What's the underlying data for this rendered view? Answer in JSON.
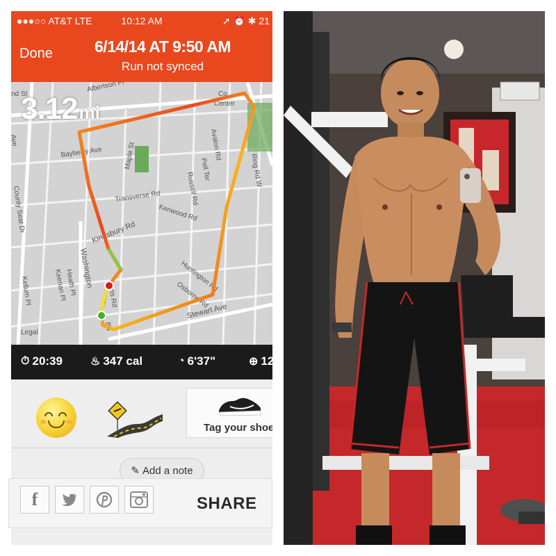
{
  "status_bar": {
    "carrier": "●●●○○ AT&T  LTE",
    "time": "10:12 AM",
    "right_icons": "➚ ⏰ ✱ 21"
  },
  "header": {
    "done_label": "Done",
    "title": "6/14/14 AT 9:50 AM",
    "subtitle": "Run not synced"
  },
  "map": {
    "distance_value": "3.12",
    "distance_unit": "mi",
    "legal": "Legal",
    "street_labels": [
      "Albertson Pl",
      "Bayberry Ave",
      "Maple St",
      "Transverse Rd",
      "Kenwood Rd",
      "Russell Rd",
      "Avalon Rd",
      "Pell Ter",
      "Ring Rd W",
      "County Seat Dr",
      "Kingsbury Rd",
      "Huntington Rd",
      "Osborne Rd",
      "Washington",
      "Heath Pl",
      "Keenan Pl",
      "Kellum Pl",
      "Stewart Ave",
      "ferts Rd",
      "Bu",
      "Co",
      "Ave",
      "nd St",
      "Center"
    ]
  },
  "stats": {
    "duration": "20:39",
    "calories": "347 cal",
    "pace": "6'37\"",
    "extra": "12"
  },
  "tags": {
    "shoe_label": "Tag your shoe"
  },
  "note": {
    "label": "Add a note"
  },
  "share": {
    "label": "SHARE",
    "buttons": [
      "facebook-icon",
      "twitter-icon",
      "pinterest-icon",
      "instagram-icon"
    ]
  },
  "colors": {
    "nike_orange": "#e9481e",
    "stats_bar": "#1b1b1b",
    "route_start": "#4caf2a",
    "route_end": "#d61a1a"
  }
}
